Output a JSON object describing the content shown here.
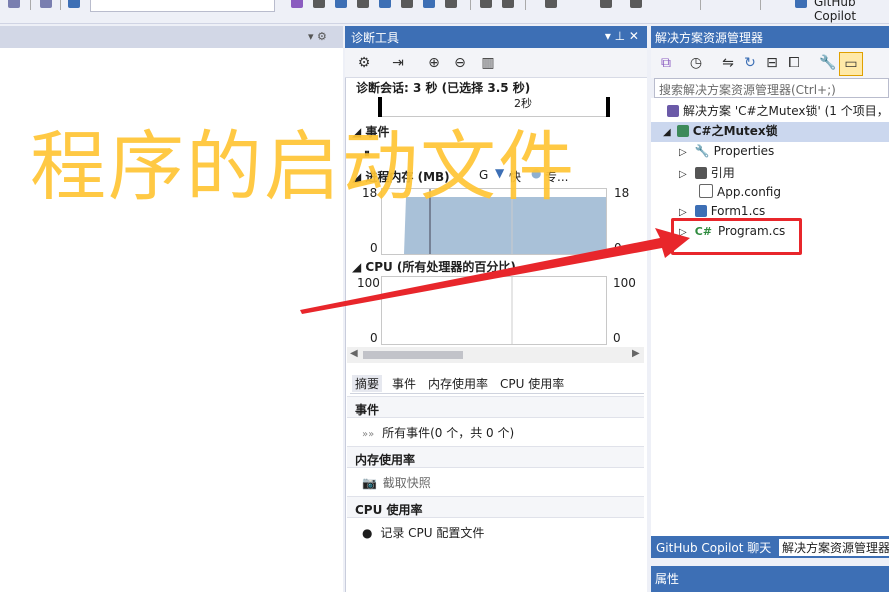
{
  "toolbar": {
    "right_label": "GitHub Copilot"
  },
  "left_pane": {
    "controls": "▾  ⚙"
  },
  "diag": {
    "title": "诊断工具",
    "title_controls": "▾ ⊥ ✕",
    "session": "诊断会话: 3 秒 (已选择 3.5 秒)",
    "timeline_label": "2秒",
    "events_label": "事件",
    "memory_header": "进程内存 (MB)",
    "memory_legend_g": "G",
    "memory_legend_fast": "快",
    "memory_legend_dedicated": "专...",
    "mem_max_left": "18",
    "mem_max_right": "18",
    "mem_min_left": "0",
    "mem_min_right": "0",
    "cpu_header": "CPU (所有处理器的百分比)",
    "cpu_max_left": "100",
    "cpu_max_right": "100",
    "cpu_min_left": "0",
    "cpu_min_right": "0",
    "tabs": [
      "摘要",
      "事件",
      "内存使用率",
      "CPU 使用率"
    ],
    "events_group": "事件",
    "events_item": "所有事件(0 个，共 0 个)",
    "memory_group": "内存使用率",
    "memory_item": "截取快照",
    "cpu_group": "CPU 使用率",
    "cpu_item": "记录 CPU 配置文件"
  },
  "solution": {
    "title": "解决方案资源管理器",
    "search_placeholder": "搜索解决方案资源管理器(Ctrl+;)",
    "tree": [
      "解决方案 'C#之Mutex锁' (1 个项目，",
      "C#之Mutex锁",
      "Properties",
      "引用",
      "App.config",
      "Form1.cs",
      "Program.cs"
    ],
    "bottom_tabs": [
      "GitHub Copilot 聊天",
      "解决方案资源管理器"
    ],
    "properties_title": "属性"
  },
  "overlay_text": "程序的启动文件",
  "colors": {
    "accent": "#3d6fb5",
    "overlay": "#ffc535",
    "arrow": "#e8262b"
  }
}
